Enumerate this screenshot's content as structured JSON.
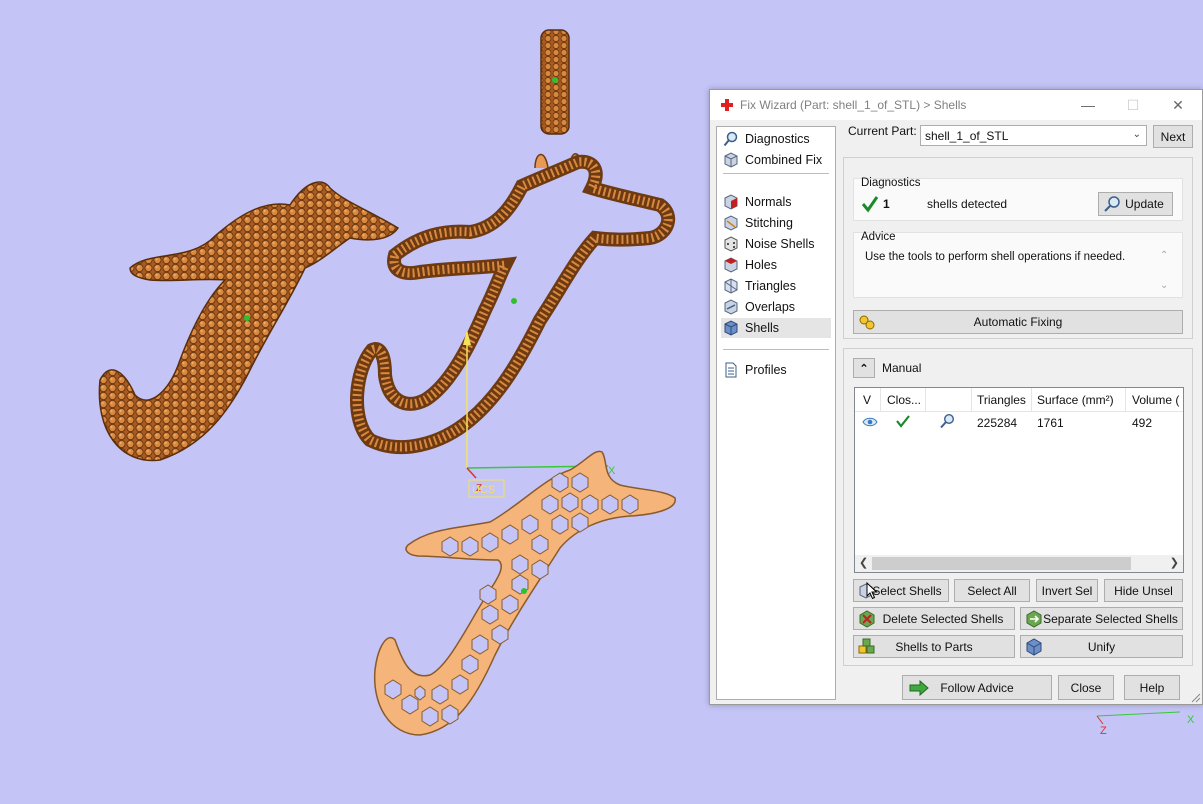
{
  "window": {
    "title": "Fix Wizard (Part: shell_1_of_STL) > Shells"
  },
  "nav": {
    "items": [
      {
        "label": "Diagnostics",
        "icon": "magnifier-icon"
      },
      {
        "label": "Combined Fix",
        "icon": "cube-icon"
      },
      {
        "label": "Normals",
        "icon": "cube-red-face-icon"
      },
      {
        "label": "Stitching",
        "icon": "cube-stitch-icon"
      },
      {
        "label": "Noise Shells",
        "icon": "dice-icon"
      },
      {
        "label": "Holes",
        "icon": "cube-hole-icon"
      },
      {
        "label": "Triangles",
        "icon": "triangle-mesh-icon"
      },
      {
        "label": "Overlaps",
        "icon": "overlap-icon"
      },
      {
        "label": "Shells",
        "icon": "cube-blue-icon"
      },
      {
        "label": "Profiles",
        "icon": "document-icon"
      }
    ],
    "selected": "Shells"
  },
  "current_part": {
    "label": "Current Part:",
    "value": "shell_1_of_STL",
    "next_label": "Next"
  },
  "diagnostics": {
    "heading": "Diagnostics",
    "count": "1",
    "text": "shells detected",
    "update_label": "Update"
  },
  "advice": {
    "heading": "Advice",
    "text": "Use the tools to perform shell operations if needed.",
    "auto_fix_label": "Automatic Fixing"
  },
  "manual": {
    "label": "Manual",
    "columns": [
      "V",
      "Clos...",
      "",
      "Triangles",
      "Surface (mm²)",
      "Volume ("
    ],
    "rows": [
      {
        "triangles": "225284",
        "surface": "1761",
        "volume": "492"
      }
    ],
    "buttons": {
      "select_shells": "Select Shells",
      "select_all": "Select All",
      "invert_sel": "Invert Sel",
      "hide_unsel": "Hide Unsel",
      "delete_selected": "Delete Selected Shells",
      "separate_selected": "Separate Selected Shells",
      "shells_to_parts": "Shells to Parts",
      "unify": "Unify"
    }
  },
  "footer": {
    "follow_advice": "Follow Advice",
    "close": "Close",
    "help": "Help"
  },
  "viewport": {
    "ucs_label": "UCS",
    "axis_x": "X",
    "axis_z": "Z",
    "mini_axis_x": "X",
    "mini_axis_z": "Z"
  },
  "colors": {
    "background": "#c4c4f7",
    "gem_fill": "#c77a3a",
    "gem_dark": "#6e3a12",
    "gold_fill": "#f5b57a",
    "check_green": "#1a8a2a"
  }
}
